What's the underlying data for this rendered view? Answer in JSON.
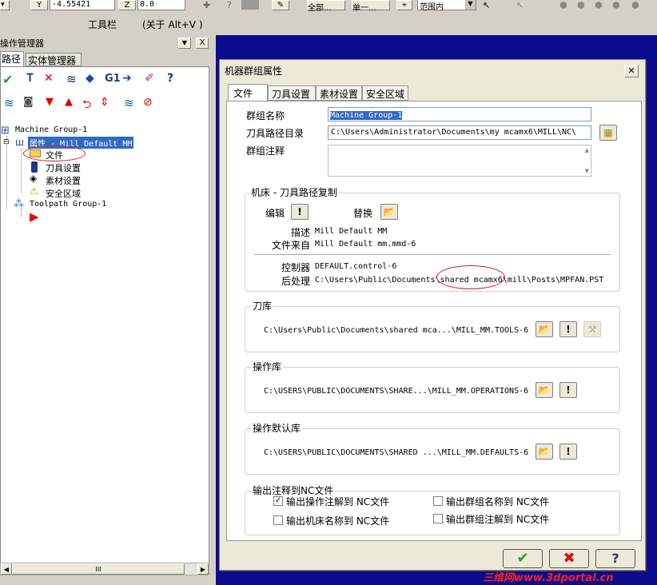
{
  "toolbar_top": {
    "y_label": "Y",
    "y_value": "-4.55421",
    "z_label": "Z",
    "z_value": "0.0",
    "combo_all": "全部...",
    "combo_single": "单一...",
    "combo_range": "范围内"
  },
  "statusline": {
    "toolbar_label": "工具栏",
    "about_label": "(关于 Alt+V )"
  },
  "op_manager": {
    "title": "操作管理器",
    "tabs": [
      "路径",
      "实体管理器"
    ],
    "g1_label": "G1",
    "tree": {
      "machine_group": "Machine Group-1",
      "properties": "属性 - Mill Default MM",
      "files": "文件",
      "tool_settings": "刀具设置",
      "stock_setup": "素材设置",
      "safety_zone": "安全区域",
      "toolpath_group": "Toolpath Group-1"
    },
    "scrollbar_grip": "III"
  },
  "dialog": {
    "title": "机器群组属性",
    "tabs": [
      "文件",
      "刀具设置",
      "素材设置",
      "安全区域"
    ],
    "group_name_label": "群组名称",
    "group_name_value": "Machine Group-1",
    "toolpath_dir_label": "刀具路径目录",
    "toolpath_dir_value": "C:\\Users\\Administrator\\Documents\\my mcamx6\\MILL\\NC\\",
    "group_comment_label": "群组注释",
    "machine_section": {
      "label": "机床 - 刀具路径复制",
      "edit_label": "编辑",
      "replace_label": "替换",
      "desc_label": "描述",
      "desc_value": "Mill Default MM",
      "file_from_label": "文件来自",
      "file_from_value": "Mill Default mm.mmd-6",
      "controller_label": "控制器",
      "controller_value": "DEFAULT.control-6",
      "post_label": "后处理",
      "post_value": "C:\\Users\\Public\\Documents\\shared mcamx6\\mill\\Posts\\MPFAN.PST"
    },
    "tool_library": {
      "label": "刀库",
      "path": "C:\\Users\\Public\\Documents\\shared mca...\\MILL_MM.TOOLS-6"
    },
    "op_library": {
      "label": "操作库",
      "path": "C:\\USERS\\PUBLIC\\DOCUMENTS\\SHARE...\\MILL_MM.OPERATIONS-6"
    },
    "op_defaults": {
      "label": "操作默认库",
      "path": "C:\\USERS\\PUBLIC\\DOCUMENTS\\SHARED ...\\MILL_MM.DEFAULTS-6"
    },
    "output_section": {
      "label": "输出注释到NC文件",
      "options": [
        {
          "label": "输出操作注解到 NC文件",
          "checked": true
        },
        {
          "label": "输出群组名称到 NC文件",
          "checked": false
        },
        {
          "label": "输出机床名称到 NC文件",
          "checked": false
        },
        {
          "label": "输出群组注解到 NC文件",
          "checked": false
        }
      ]
    }
  },
  "watermark": "三维网www.3dportal.cn"
}
